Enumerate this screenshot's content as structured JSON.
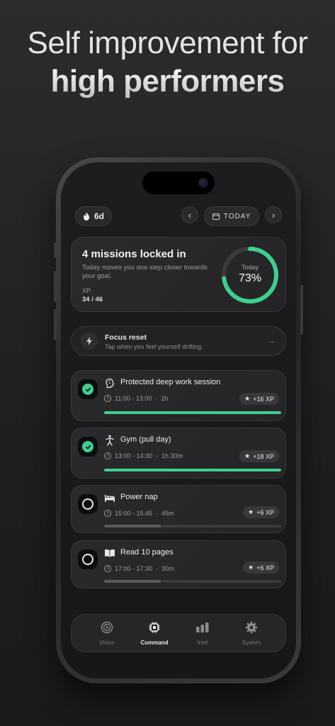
{
  "headline": {
    "line1": "Self improvement for",
    "line2": "high performers"
  },
  "topbar": {
    "streak": "6d",
    "prev": "‹",
    "next": "›",
    "today": "TODAY"
  },
  "hero": {
    "title": "4 missions locked in",
    "subtitle": "Today moves you one step closer towards your goal.",
    "xp_label": "XP",
    "xp_value": "34 / 46",
    "ring_label": "Today",
    "ring_percent": "73%",
    "progress": 0.73
  },
  "focus": {
    "title": "Focus reset",
    "subtitle": "Tap when you feel yourself drifting.",
    "arrow": "→"
  },
  "tasks": [
    {
      "name": "Protected deep work session",
      "time": "11:00 - 13:00",
      "duration": "2h",
      "xp": "+16 XP",
      "done": true,
      "icon": "brain-icon",
      "progress": 1.0
    },
    {
      "name": "Gym (pull day)",
      "time": "13:00 - 14:30",
      "duration": "1h 30m",
      "xp": "+18 XP",
      "done": true,
      "icon": "person-walking-icon",
      "progress": 1.0
    },
    {
      "name": "Power nap",
      "time": "15:00 - 15:45",
      "duration": "45m",
      "xp": "+6 XP",
      "done": false,
      "icon": "bed-icon",
      "progress": 0.32
    },
    {
      "name": "Read 10 pages",
      "time": "17:00 - 17:30",
      "duration": "30m",
      "xp": "+6 XP",
      "done": false,
      "icon": "book-icon",
      "progress": 0.32
    }
  ],
  "tabs": [
    {
      "label": "Vision",
      "icon": "target-icon",
      "active": false
    },
    {
      "label": "Command",
      "icon": "chip-icon",
      "active": true
    },
    {
      "label": "Intel",
      "icon": "bar-chart-icon",
      "active": false
    },
    {
      "label": "System",
      "icon": "gear-icon",
      "active": false
    }
  ],
  "colors": {
    "accent": "#3ecf8e",
    "background": "#1d1d1f",
    "card": "#2a2a2c"
  }
}
